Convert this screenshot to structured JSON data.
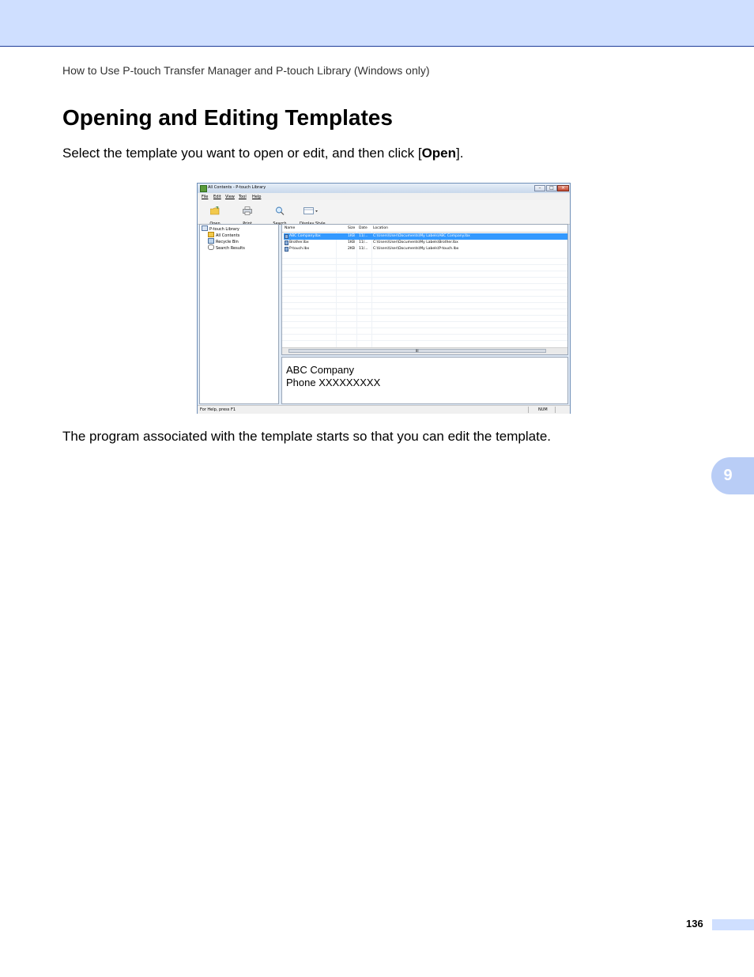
{
  "header": {
    "running_title": "How to Use P-touch Transfer Manager and P-touch Library (Windows only)"
  },
  "page": {
    "title": "Opening and Editing Templates",
    "intro_before": "Select the template you want to open or edit, and then click [",
    "intro_bold": "Open",
    "intro_after": "].",
    "outro": "The program associated with the template starts so that you can edit the template.",
    "chapter_tab": "9",
    "page_number": "136"
  },
  "screenshot": {
    "window_title": "All Contents - P-touch Library",
    "window_controls": {
      "minimize": "–",
      "maximize": "□",
      "close": "×"
    },
    "menu": [
      "File",
      "Edit",
      "View",
      "Tool",
      "Help"
    ],
    "toolbar": [
      {
        "label": "Open",
        "icon": "folder-open-icon"
      },
      {
        "label": "Print",
        "icon": "printer-icon"
      },
      {
        "label": "Search",
        "icon": "magnifier-icon"
      },
      {
        "label": "Display Style",
        "icon": "display-style-icon"
      }
    ],
    "tree": {
      "root": "P-touch Library",
      "children": [
        "All Contents",
        "Recycle Bin",
        "Search Results"
      ]
    },
    "columns": [
      "Name",
      "Size",
      "Date",
      "Location"
    ],
    "rows": [
      {
        "name": "ABC Company.lbx",
        "size": "1KB",
        "date": "11/...",
        "location": "C:\\Users\\User\\Documents\\My Labels\\ABC Company.lbx",
        "selected": true
      },
      {
        "name": "Brother.lbx",
        "size": "1KB",
        "date": "11/...",
        "location": "C:\\Users\\User\\Documents\\My Labels\\Brother.lbx",
        "selected": false
      },
      {
        "name": "P-touch.lbx",
        "size": "2KB",
        "date": "11/...",
        "location": "C:\\Users\\User\\Documents\\My Labels\\P-touch.lbx",
        "selected": false
      }
    ],
    "scroll_marker": "III",
    "preview_lines": [
      "ABC Company",
      "Phone XXXXXXXXX"
    ],
    "status": {
      "help_text": "For Help, press F1",
      "num": "NUM"
    },
    "colors": {
      "selection": "#3399ff",
      "title_bar": "#c8d8ec"
    }
  }
}
